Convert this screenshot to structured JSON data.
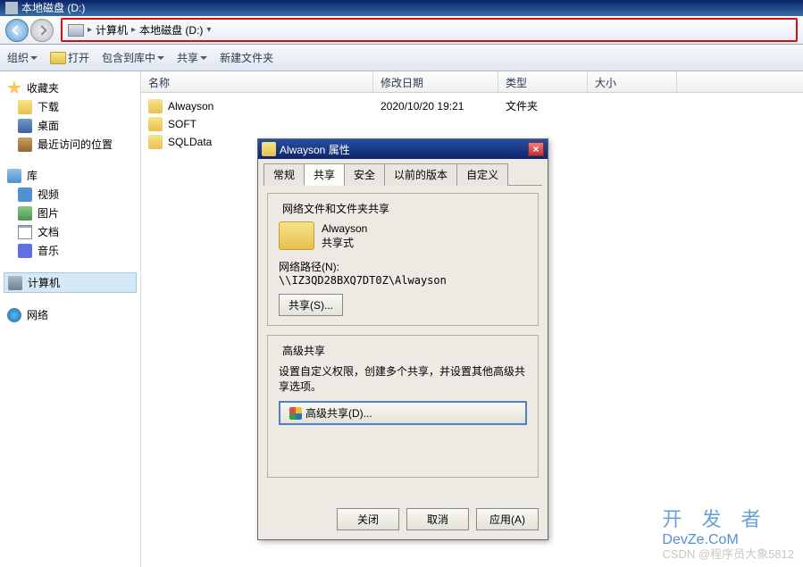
{
  "titlebar": {
    "title": "本地磁盘 (D:)"
  },
  "nav": {
    "computer": "计算机",
    "drive": "本地磁盘 (D:)"
  },
  "toolbar": {
    "organize": "组织",
    "open": "打开",
    "include": "包含到库中",
    "share": "共享",
    "new_folder": "新建文件夹"
  },
  "sidebar": {
    "favorites": "收藏夹",
    "downloads": "下载",
    "desktop": "桌面",
    "recent": "最近访问的位置",
    "library": "库",
    "video": "视频",
    "pictures": "图片",
    "documents": "文档",
    "music": "音乐",
    "computer": "计算机",
    "network": "网络"
  },
  "columns": {
    "name": "名称",
    "modified": "修改日期",
    "type": "类型",
    "size": "大小"
  },
  "files": [
    {
      "name": "Alwayson",
      "modified": "2020/10/20 19:21",
      "type": "文件夹"
    },
    {
      "name": "SOFT",
      "modified": "",
      "type": ""
    },
    {
      "name": "SQLData",
      "modified": "",
      "type": ""
    }
  ],
  "dialog": {
    "title": "Alwayson 属性",
    "tabs": {
      "general": "常规",
      "sharing": "共享",
      "security": "安全",
      "prev": "以前的版本",
      "custom": "自定义"
    },
    "group1": {
      "title": "网络文件和文件夹共享",
      "name": "Alwayson",
      "status": "共享式",
      "path_label": "网络路径(N):",
      "path": "\\\\IZ3QD28BXQ7DT0Z\\Alwayson",
      "share_btn": "共享(S)..."
    },
    "group2": {
      "title": "高级共享",
      "desc": "设置自定义权限，创建多个共享，并设置其他高级共享选项。",
      "btn": "高级共享(D)..."
    },
    "footer": {
      "close": "关闭",
      "cancel": "取消",
      "apply": "应用(A)"
    }
  },
  "watermark": {
    "cn": "开 发 者",
    "en": "DevZe.CoM",
    "csdn": "CSDN @程序员大象5812"
  }
}
